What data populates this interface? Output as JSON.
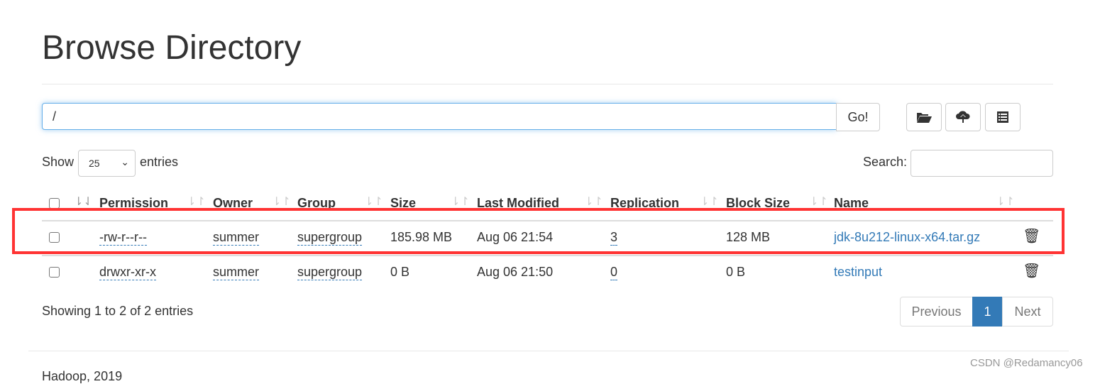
{
  "title": "Browse Directory",
  "path": {
    "value": "/",
    "go_label": "Go!"
  },
  "toolbar": {
    "icons": [
      "folder-open-icon",
      "cloud-upload-icon",
      "list-icon"
    ]
  },
  "show": {
    "prefix": "Show",
    "value": "25",
    "suffix": "entries"
  },
  "search": {
    "label": "Search:",
    "value": ""
  },
  "columns": [
    "Permission",
    "Owner",
    "Group",
    "Size",
    "Last Modified",
    "Replication",
    "Block Size",
    "Name"
  ],
  "rows": [
    {
      "permission": "-rw-r--r--",
      "owner": "summer",
      "group": "supergroup",
      "size": "185.98 MB",
      "modified": "Aug 06 21:54",
      "replication": "3",
      "block_size": "128 MB",
      "name": "jdk-8u212-linux-x64.tar.gz",
      "highlighted": true
    },
    {
      "permission": "drwxr-xr-x",
      "owner": "summer",
      "group": "supergroup",
      "size": "0 B",
      "modified": "Aug 06 21:50",
      "replication": "0",
      "block_size": "0 B",
      "name": "testinput",
      "highlighted": false
    }
  ],
  "info": "Showing 1 to 2 of 2 entries",
  "pagination": {
    "previous": "Previous",
    "current": "1",
    "next": "Next"
  },
  "footer": "Hadoop, 2019",
  "watermark": "CSDN @Redamancy06",
  "colors": {
    "link": "#337ab7",
    "highlight_box": "#ff3333",
    "active_page": "#337ab7"
  }
}
